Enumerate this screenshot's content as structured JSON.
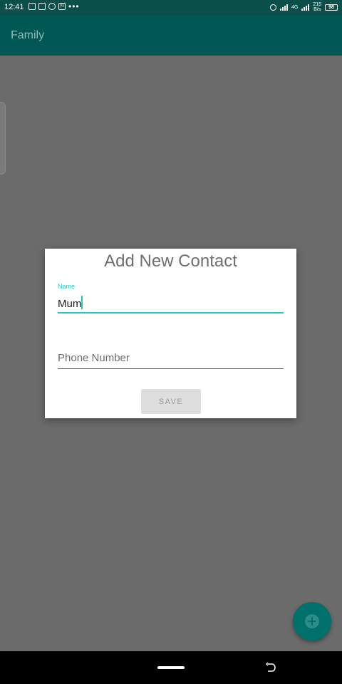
{
  "status_bar": {
    "time": "12:41",
    "left_icons": [
      "gallery-icon",
      "news-icon",
      "whatsapp-icon",
      "calendar-icon"
    ],
    "calendar_day": "31",
    "more_dots": "•••",
    "network_type": "4G",
    "speed_value": "215",
    "speed_unit": "B/s",
    "battery": "98"
  },
  "app_bar": {
    "title": "Family"
  },
  "dialog": {
    "title": "Add New Contact",
    "name_label": "Name",
    "name_value": "Mum",
    "phone_placeholder": "Phone Number",
    "save_label": "SAVE"
  },
  "fab": {
    "icon": "add-circle-icon"
  },
  "colors": {
    "accent": "#1fc9c1",
    "app_bar": "#005753",
    "status_bar": "#0a4f4a",
    "fab": "#00706a",
    "scrim": "#6b6b6b"
  }
}
